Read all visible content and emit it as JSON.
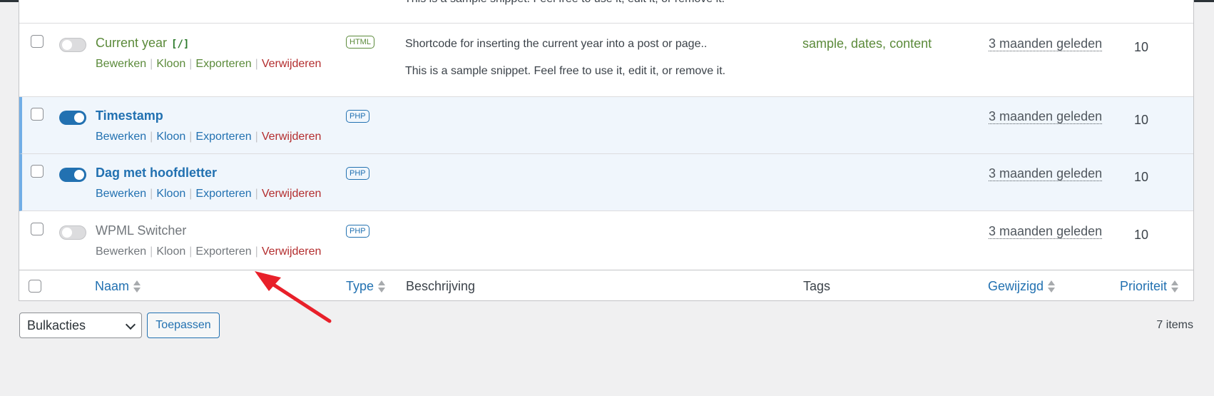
{
  "cut_description": "This is a sample snippet. Feel free to use it, edit it, or remove it.",
  "rows": [
    {
      "title": "Current year",
      "shortcode_tag": "[/]",
      "type": "HTML",
      "description": "Shortcode for inserting the current year into a post or page..",
      "description2": "This is a sample snippet. Feel free to use it, edit it, or remove it.",
      "tags": "sample, dates, content",
      "modified": "3 maanden geleden",
      "priority": "10",
      "active": false
    },
    {
      "title": "Timestamp",
      "type": "PHP",
      "modified": "3 maanden geleden",
      "priority": "10",
      "active": true
    },
    {
      "title": "Dag met hoofdletter",
      "type": "PHP",
      "modified": "3 maanden geleden",
      "priority": "10",
      "active": true
    },
    {
      "title": "WPML Switcher",
      "type": "PHP",
      "modified": "3 maanden geleden",
      "priority": "10",
      "active": false
    }
  ],
  "row_actions": {
    "edit": "Bewerken",
    "clone": "Kloon",
    "export": "Exporteren",
    "delete": "Verwijderen",
    "separator": "|"
  },
  "columns": {
    "name": "Naam",
    "type": "Type",
    "description": "Beschrijving",
    "tags": "Tags",
    "modified": "Gewijzigd",
    "priority": "Prioriteit"
  },
  "bulk": {
    "select_label": "Bulkacties",
    "apply_label": "Toepassen",
    "item_count": "7 items"
  },
  "colors": {
    "accent": "#2271b1",
    "delete": "#b32d2e",
    "inactive_green": "#5b8a3a",
    "annotation_arrow": "#e8202a"
  }
}
